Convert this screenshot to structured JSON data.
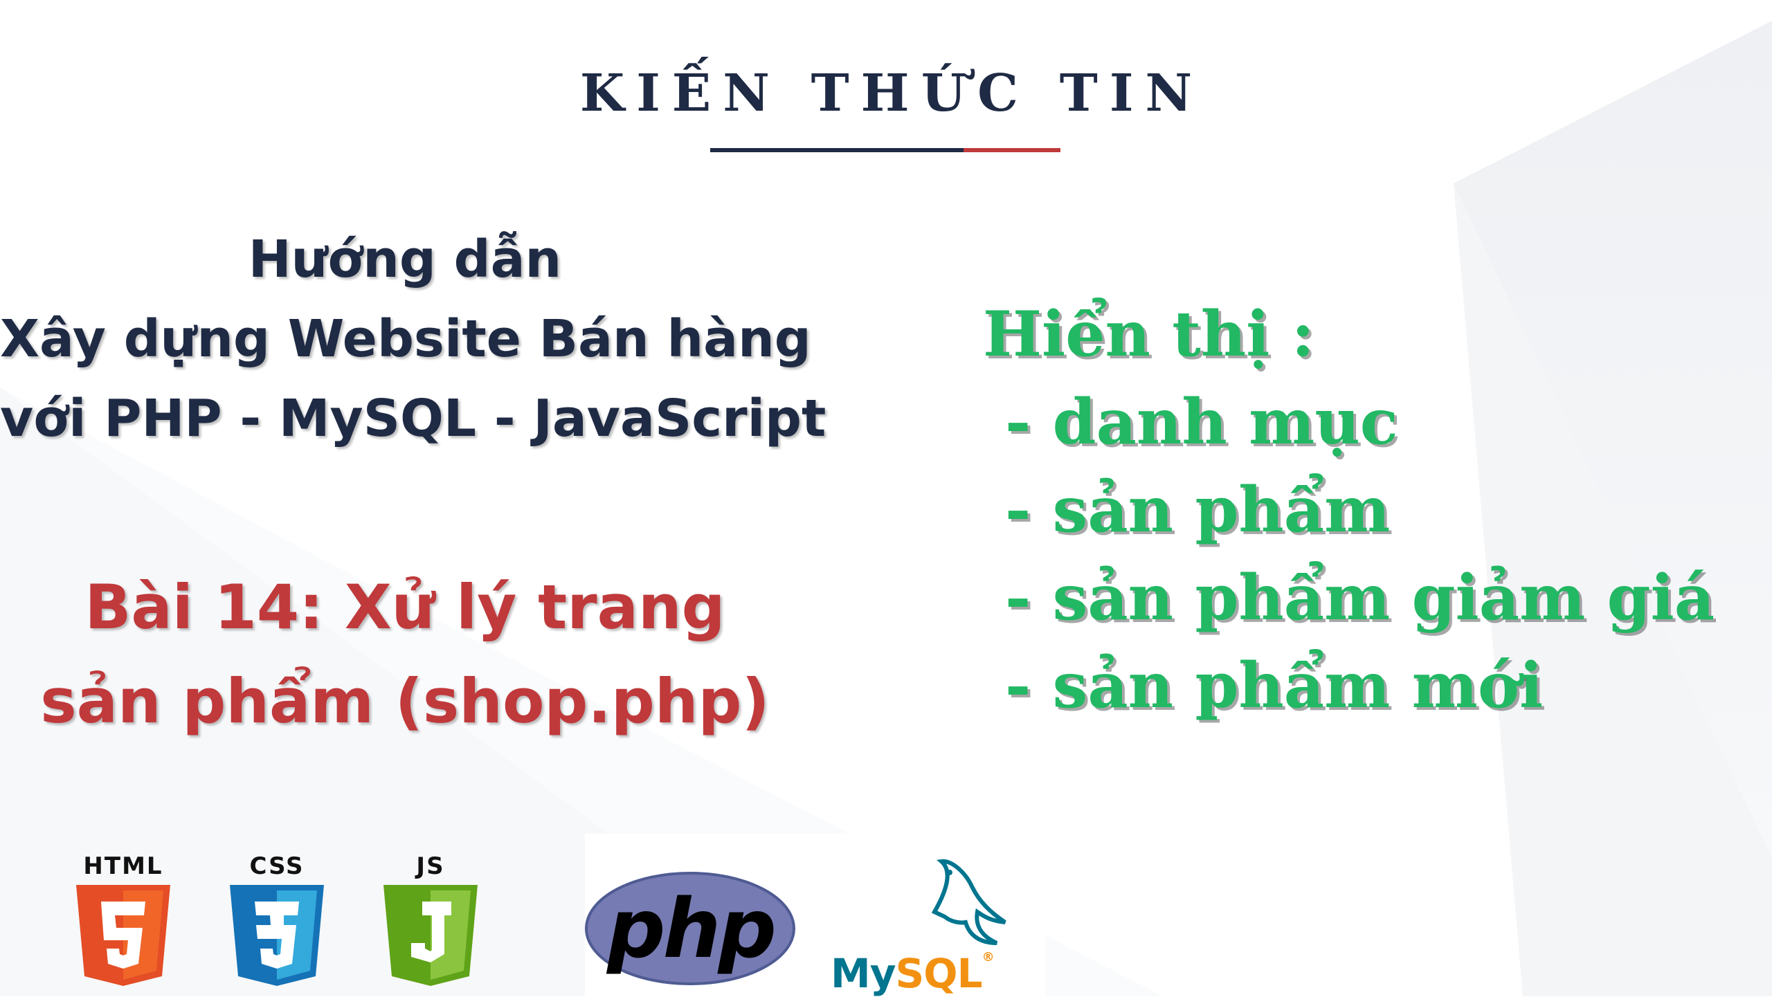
{
  "brand": {
    "title": "KIẾN THỨC TIN"
  },
  "guide": {
    "lines": [
      "Hướng dẫn",
      "Xây dựng Website Bán hàng",
      "với PHP - MySQL - JavaScript"
    ]
  },
  "lesson": {
    "lines": [
      "Bài 14: Xử lý trang",
      "sản phẩm (shop.php)"
    ]
  },
  "display": {
    "heading": "Hiển thị :",
    "items": [
      "- danh mục",
      "- sản phẩm",
      "- sản phẩm giảm giá",
      "- sản phẩm mới"
    ]
  },
  "logos": {
    "html": {
      "label": "HTML",
      "digit": "5",
      "color": "#e44d26",
      "color_dark": "#f16529"
    },
    "css": {
      "label": "CSS",
      "digit": "3",
      "color": "#1572b6",
      "color_dark": "#33a9dc"
    },
    "js": {
      "label": "JS",
      "digit": "J",
      "color": "#5fa318",
      "color_dark": "#8bc53f"
    },
    "php": {
      "text": "php",
      "color": "#777bb3"
    },
    "mysql": {
      "my": "My",
      "sql": "SQL",
      "reg": "®",
      "color_my": "#00758f",
      "color_sql": "#f29111"
    }
  },
  "colors": {
    "navy": "#1f2a44",
    "red": "#c0393b",
    "green": "#22b864"
  }
}
